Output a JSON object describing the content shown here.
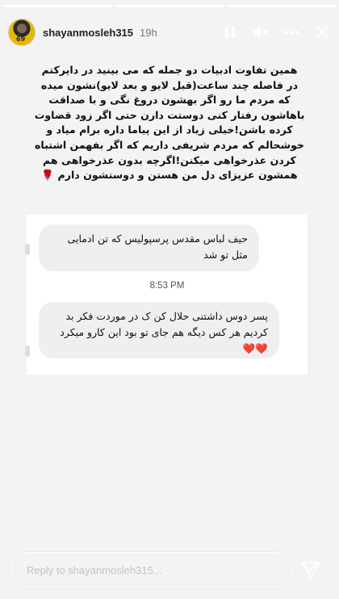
{
  "story": {
    "segments": [
      {
        "state": "viewed"
      },
      {
        "state": "current"
      },
      {
        "state": "viewed"
      }
    ],
    "header": {
      "username": "shayanmosleh315",
      "time": "19h",
      "avatar_text": "69",
      "icons": [
        "pause-icon",
        "mute-icon",
        "more-icon",
        "close-icon"
      ]
    },
    "caption_lines": [
      "همین تفاوت ادبیات دو جمله که می بینید در دایرکتم",
      "در فاصله چند ساعت(قبل لایو و بعد لایو)نشون میده",
      "که مردم ما رو اگر بهشون دروغ نگی و با صداقت",
      "باهاشون رفتار کنی دوستت دارن حتی اگر زود قضاوت",
      "کرده باشن!خیلی زیاد از این پیاما داره برام میاد و",
      "خوشحالم که مردم شریفی داریم که اگر بفهمن اشتباه",
      "کردن عذرخواهی میکنن!اگرچه بدون عذرخواهی هم",
      "همشون عزیزای دل من هستن و دوستشون دارم 🌹"
    ],
    "dm": {
      "message1": "حیف لباس مقدس پرسپولیس که تن ادمایی مثل تو شد",
      "timestamp": "8:53 PM",
      "message2": "پسر دوس داشتنی حلال کن ک در موردت فکر بد کردیم هر کس دیگه هم جای تو بود این کارو میکرد ❤️❤️"
    },
    "reply": {
      "placeholder": "Reply to shayanmosleh315..."
    },
    "colors": {
      "background": "#f3f3f3",
      "card": "#ffffff",
      "bubble": "#efefef"
    }
  }
}
